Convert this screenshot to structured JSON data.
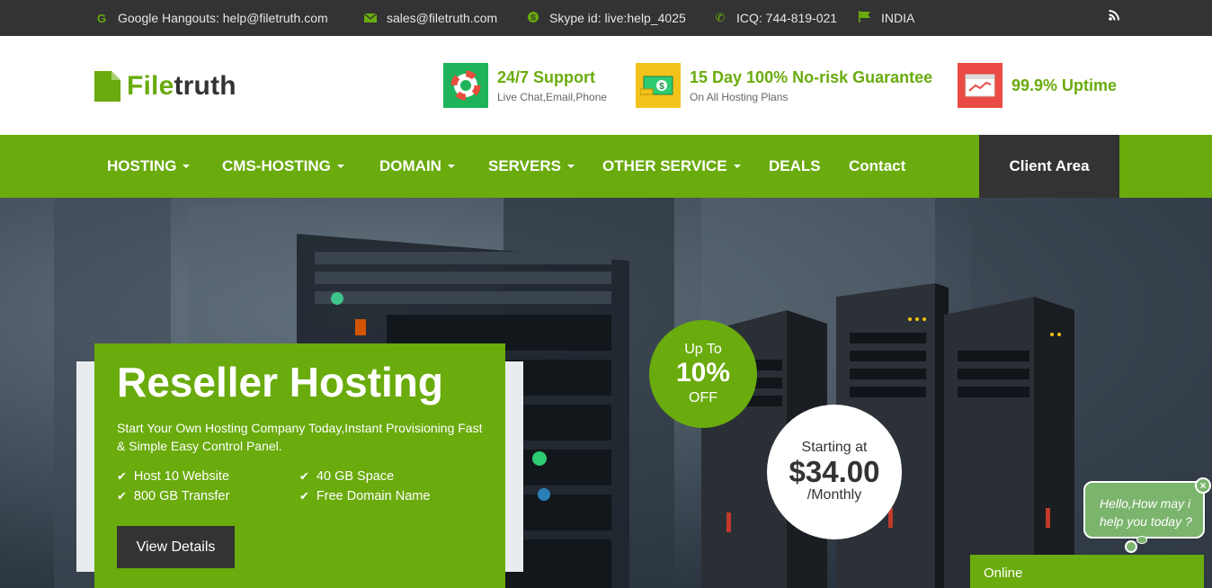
{
  "colors": {
    "brand": "#6aab0d",
    "dark": "#333333",
    "support_icon_bg": "#1eb35a",
    "guarantee_icon_bg": "#f3c21a",
    "uptime_icon_bg": "#ea4b45"
  },
  "topbar": {
    "hangouts": {
      "icon": "google-icon",
      "text": "Google Hangouts: help@filetruth.com"
    },
    "email": {
      "icon": "envelope-icon",
      "text": "sales@filetruth.com"
    },
    "skype": {
      "icon": "skype-icon",
      "text": "Skype id: live:help_4025"
    },
    "icq": {
      "icon": "phone-icon",
      "text": "ICQ: 744-819-021"
    },
    "country": {
      "icon": "flag-icon",
      "text": "INDIA"
    },
    "rss_icon": "rss-icon"
  },
  "logo": {
    "part1": "File",
    "part2": "truth",
    "icon": "file-icon"
  },
  "features": [
    {
      "icon": "lifebuoy-icon",
      "title": "24/7 Support",
      "subtitle": "Live Chat,Email,Phone"
    },
    {
      "icon": "money-icon",
      "title": "15 Day 100% No-risk Guarantee",
      "subtitle": "On All Hosting Plans"
    },
    {
      "icon": "browser-icon",
      "title": "99.9% Uptime",
      "subtitle": ""
    }
  ],
  "nav": {
    "items": [
      {
        "label": "HOSTING",
        "dropdown": true
      },
      {
        "label": "CMS-HOSTING",
        "dropdown": true
      },
      {
        "label": "DOMAIN",
        "dropdown": true
      },
      {
        "label": "SERVERS",
        "dropdown": true
      },
      {
        "label": "OTHER SERVICE",
        "dropdown": true
      },
      {
        "label": "DEALS",
        "dropdown": false
      },
      {
        "label": "Contact",
        "dropdown": false
      }
    ],
    "client_area": "Client Area"
  },
  "hero": {
    "title": "Reseller Hosting",
    "description": "Start Your Own Hosting Company Today,Instant Provisioning Fast & Simple Easy Control Panel.",
    "features": [
      "Host 10 Website",
      "40 GB Space",
      "800 GB Transfer",
      "Free Domain Name"
    ],
    "button": "View Details",
    "discount": {
      "line1": "Up To",
      "line2": "10%",
      "line3": "OFF"
    },
    "price": {
      "line1": "Starting at",
      "line2": "$34.00",
      "line3": "/Monthly"
    }
  },
  "chat": {
    "greeting_line1": "Hello,How may i",
    "greeting_line2": "help you today ?",
    "close": "×",
    "status": "Online"
  }
}
